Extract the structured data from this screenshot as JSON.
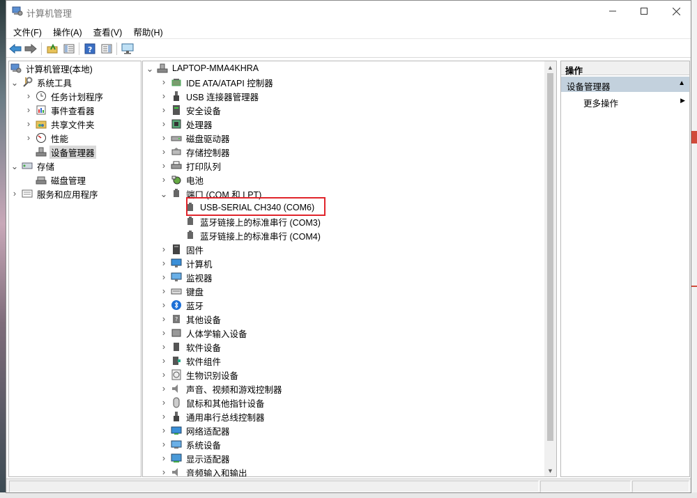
{
  "window": {
    "title": "计算机管理"
  },
  "menu": [
    "文件(F)",
    "操作(A)",
    "查看(V)",
    "帮助(H)"
  ],
  "left_tree": {
    "root": "计算机管理(本地)",
    "system_tools": "系统工具",
    "task_scheduler": "任务计划程序",
    "event_viewer": "事件查看器",
    "shared_folders": "共享文件夹",
    "performance": "性能",
    "device_manager": "设备管理器",
    "storage": "存储",
    "disk_management": "磁盘管理",
    "services_apps": "服务和应用程序"
  },
  "device_tree": {
    "computer": "LAPTOP-MMA4KHRA",
    "categories": [
      "IDE ATA/ATAPI 控制器",
      "USB 连接器管理器",
      "安全设备",
      "处理器",
      "磁盘驱动器",
      "存储控制器",
      "打印队列",
      "电池",
      "端口 (COM 和 LPT)"
    ],
    "ports": [
      "USB-SERIAL CH340 (COM6)",
      "蓝牙链接上的标准串行 (COM3)",
      "蓝牙链接上的标准串行 (COM4)"
    ],
    "more_categories": [
      "固件",
      "计算机",
      "监视器",
      "键盘",
      "蓝牙",
      "其他设备",
      "人体学输入设备",
      "软件设备",
      "软件组件",
      "生物识别设备",
      "声音、视频和游戏控制器",
      "鼠标和其他指针设备",
      "通用串行总线控制器",
      "网络适配器",
      "系统设备",
      "显示适配器",
      "音频输入和输出"
    ]
  },
  "actions": {
    "header": "操作",
    "section": "设备管理器",
    "more": "更多操作"
  }
}
